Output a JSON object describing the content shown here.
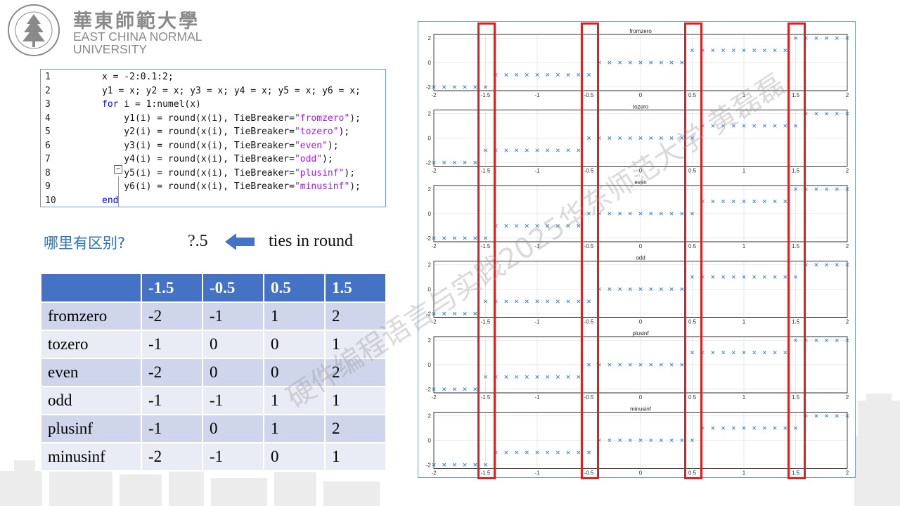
{
  "logo": {
    "cn": "華東師範大學",
    "en_line1": "EAST CHINA NORMAL",
    "en_line2": "UNIVERSITY",
    "seal_text": "EAST CHINA NORMAL UNIVERSITY"
  },
  "code": {
    "lines": [
      {
        "n": "1",
        "segs": [
          {
            "t": "x = -2:0.1:2;",
            "c": ""
          }
        ]
      },
      {
        "n": "2",
        "segs": [
          {
            "t": "y1 = x; y2 = x; y3 = x; y4 = x; y5 = x; y6 = x;",
            "c": ""
          }
        ]
      },
      {
        "n": "3",
        "segs": [
          {
            "t": "for",
            "c": "kw"
          },
          {
            "t": " i = 1:numel(x)",
            "c": ""
          }
        ]
      },
      {
        "n": "4",
        "segs": [
          {
            "t": "    y1(i) = round(x(i), TieBreaker=",
            "c": ""
          },
          {
            "t": "\"fromzero\"",
            "c": "str"
          },
          {
            "t": ");",
            "c": ""
          }
        ]
      },
      {
        "n": "5",
        "segs": [
          {
            "t": "    y2(i) = round(x(i), TieBreaker=",
            "c": ""
          },
          {
            "t": "\"tozero\"",
            "c": "str"
          },
          {
            "t": ");",
            "c": ""
          }
        ]
      },
      {
        "n": "6",
        "segs": [
          {
            "t": "    y3(i) = round(x(i), TieBreaker=",
            "c": ""
          },
          {
            "t": "\"even\"",
            "c": "str"
          },
          {
            "t": ");",
            "c": ""
          }
        ]
      },
      {
        "n": "7",
        "segs": [
          {
            "t": "    y4(i) = round(x(i), TieBreaker=",
            "c": ""
          },
          {
            "t": "\"odd\"",
            "c": "str"
          },
          {
            "t": ");",
            "c": ""
          }
        ]
      },
      {
        "n": "8",
        "segs": [
          {
            "t": "    y5(i) = round(x(i), TieBreaker=",
            "c": ""
          },
          {
            "t": "\"plusinf\"",
            "c": "str"
          },
          {
            "t": ");",
            "c": ""
          }
        ]
      },
      {
        "n": "9",
        "segs": [
          {
            "t": "    y6(i) = round(x(i), TieBreaker=",
            "c": ""
          },
          {
            "t": "\"minusinf\"",
            "c": "str"
          },
          {
            "t": ");",
            "c": ""
          }
        ]
      },
      {
        "n": "10",
        "segs": [
          {
            "t": "end",
            "c": "kw"
          }
        ]
      }
    ],
    "fold_symbol": "−"
  },
  "question": {
    "text": "哪里有区别?",
    "value": "?.5",
    "ties": "ties in round"
  },
  "table": {
    "headers": [
      "",
      "-1.5",
      "-0.5",
      "0.5",
      "1.5"
    ],
    "rows": [
      {
        "label": "fromzero",
        "vals": [
          "-2",
          "-1",
          "1",
          "2"
        ]
      },
      {
        "label": "tozero",
        "vals": [
          "-1",
          "0",
          "0",
          "1"
        ]
      },
      {
        "label": "even",
        "vals": [
          "-2",
          "0",
          "0",
          "2"
        ]
      },
      {
        "label": "odd",
        "vals": [
          "-1",
          "-1",
          "1",
          "1"
        ]
      },
      {
        "label": "plusinf",
        "vals": [
          "-1",
          "0",
          "1",
          "2"
        ]
      },
      {
        "label": "minusinf",
        "vals": [
          "-2",
          "-1",
          "0",
          "1"
        ]
      }
    ]
  },
  "watermark": "硬件编程语言与实践2025华东师范大学 黄磊磊",
  "colors": {
    "accent_blue": "#4472c4",
    "question_blue": "#2e75b6",
    "marker": "#2f7fc1",
    "highlight_red": "#e02020"
  },
  "chart_data": [
    {
      "type": "scatter",
      "title": "fromzero",
      "tiebreaker": "fromzero",
      "x": {
        "start": -2,
        "step": 0.1,
        "end": 2
      },
      "xlim": [
        -2,
        2
      ],
      "ylim": [
        -2.3,
        2.3
      ],
      "xticks": [
        "-2",
        "-1.5",
        "-1",
        "-0.5",
        "0",
        "0.5",
        "1",
        "1.5",
        "2"
      ],
      "yticks": [
        "-2",
        "0",
        "2"
      ],
      "marker": "x",
      "grid": true
    },
    {
      "type": "scatter",
      "title": "tozero",
      "tiebreaker": "tozero",
      "x": {
        "start": -2,
        "step": 0.1,
        "end": 2
      },
      "xlim": [
        -2,
        2
      ],
      "ylim": [
        -2.3,
        2.3
      ],
      "xticks": [
        "-2",
        "-1.5",
        "-1",
        "-0.5",
        "0",
        "0.5",
        "1",
        "1.5",
        "2"
      ],
      "yticks": [
        "-2",
        "0",
        "2"
      ],
      "marker": "x",
      "grid": true
    },
    {
      "type": "scatter",
      "title": "even",
      "tiebreaker": "even",
      "x": {
        "start": -2,
        "step": 0.1,
        "end": 2
      },
      "xlim": [
        -2,
        2
      ],
      "ylim": [
        -2.3,
        2.3
      ],
      "xticks": [
        "-2",
        "-1.5",
        "-1",
        "-0.5",
        "0",
        "0.5",
        "1",
        "1.5",
        "2"
      ],
      "yticks": [
        "-2",
        "0",
        "2"
      ],
      "marker": "x",
      "grid": true
    },
    {
      "type": "scatter",
      "title": "odd",
      "tiebreaker": "odd",
      "x": {
        "start": -2,
        "step": 0.1,
        "end": 2
      },
      "xlim": [
        -2,
        2
      ],
      "ylim": [
        -2.3,
        2.3
      ],
      "xticks": [
        "-2",
        "-1.5",
        "-1",
        "-0.5",
        "0",
        "0.5",
        "1",
        "1.5",
        "2"
      ],
      "yticks": [
        "-2",
        "0",
        "2"
      ],
      "marker": "x",
      "grid": true
    },
    {
      "type": "scatter",
      "title": "plusinf",
      "tiebreaker": "plusinf",
      "x": {
        "start": -2,
        "step": 0.1,
        "end": 2
      },
      "xlim": [
        -2,
        2
      ],
      "ylim": [
        -2.3,
        2.3
      ],
      "xticks": [
        "-2",
        "-1.5",
        "-1",
        "-0.5",
        "0",
        "0.5",
        "1",
        "1.5",
        "2"
      ],
      "yticks": [
        "-2",
        "0",
        "2"
      ],
      "marker": "x",
      "grid": true
    },
    {
      "type": "scatter",
      "title": "minusinf",
      "tiebreaker": "minusinf",
      "x": {
        "start": -2,
        "step": 0.1,
        "end": 2
      },
      "xlim": [
        -2,
        2
      ],
      "ylim": [
        -2.3,
        2.3
      ],
      "xticks": [
        "-2",
        "-1.5",
        "-1",
        "-0.5",
        "0",
        "0.5",
        "1",
        "1.5",
        "2"
      ],
      "yticks": [
        "-2",
        "0",
        "2"
      ],
      "marker": "x",
      "grid": true
    }
  ],
  "highlights": {
    "x_values": [
      -1.5,
      -0.5,
      0.5,
      1.5
    ]
  }
}
